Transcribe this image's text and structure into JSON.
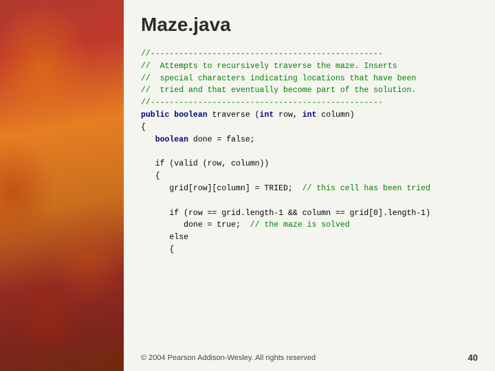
{
  "title": "Maze.java",
  "footer": {
    "copyright": "© 2004 Pearson Addison-Wesley. All rights reserved",
    "page_number": "40"
  },
  "code": {
    "lines": [
      {
        "id": "l1",
        "type": "comment",
        "text": "//-------------------------------------------------"
      },
      {
        "id": "l2",
        "type": "comment",
        "text": "//  Attempts to recursively traverse the maze. Inserts"
      },
      {
        "id": "l3",
        "type": "comment",
        "text": "//  special characters indicating locations that have been"
      },
      {
        "id": "l4",
        "type": "comment",
        "text": "//  tried and that eventually become part of the solution."
      },
      {
        "id": "l5",
        "type": "comment",
        "text": "//-------------------------------------------------"
      },
      {
        "id": "l6",
        "type": "mixed",
        "text": "public boolean traverse (int row, int column)"
      },
      {
        "id": "l7",
        "type": "plain",
        "text": "{"
      },
      {
        "id": "l8",
        "type": "mixed",
        "text": "   boolean done = false;"
      },
      {
        "id": "l9",
        "type": "blank",
        "text": ""
      },
      {
        "id": "l10",
        "type": "mixed",
        "text": "   if (valid (row, column))"
      },
      {
        "id": "l11",
        "type": "plain",
        "text": "   {"
      },
      {
        "id": "l12",
        "type": "mixed",
        "text": "      grid[row][column] = TRIED;  // this cell has been tried"
      },
      {
        "id": "l13",
        "type": "blank",
        "text": ""
      },
      {
        "id": "l14",
        "type": "mixed",
        "text": "      if (row == grid.length-1 && column == grid[0].length-1)"
      },
      {
        "id": "l15",
        "type": "mixed",
        "text": "         done = true;  // the maze is solved"
      },
      {
        "id": "l16",
        "type": "plain",
        "text": "      else"
      },
      {
        "id": "l17",
        "type": "plain",
        "text": "      {"
      }
    ]
  }
}
